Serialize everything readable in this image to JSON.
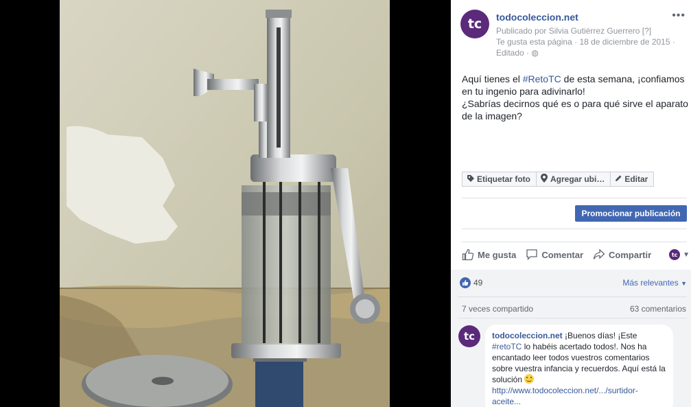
{
  "post": {
    "page_name": "todocoleccion.net",
    "avatar_text": "tc",
    "published_by": "Publicado por Silvia Gutiérrez Guerrero",
    "help_mark": "[?]",
    "liked_page": "Te gusta esta página",
    "date": "18 de diciembre de 2015",
    "edited": "Editado",
    "text_line1_prefix": "Aquí tienes el ",
    "text_hashtag": "#RetoTC",
    "text_line1_suffix": " de esta semana, ¡confiamos en tu ingenio para adivinarlo!",
    "text_line2": "¿Sabrías decirnos qué es o para qué sirve el aparato de la imagen?"
  },
  "photo_buttons": {
    "tag": "Etiquetar foto",
    "location": "Agregar ubi…",
    "edit": "Editar"
  },
  "promote_label": "Promocionar publicación",
  "actions": {
    "like": "Me gusta",
    "comment": "Comentar",
    "share": "Compartir"
  },
  "stats": {
    "likes": "49",
    "sort": "Más relevantes",
    "shares": "7 veces compartido",
    "comments": "63 comentarios"
  },
  "comment": {
    "author": "todocoleccion.net",
    "text_part1": " ¡Buenos días! ¡Este ",
    "hashtag": "#retoTC",
    "text_part2": " lo habéis acertado todos!. Nos ha encantado leer todos vuestros comentarios sobre vuestra infancia y recuerdos. Aquí está la solución ",
    "link": "http://www.todocoleccion.net/.../surtidor-aceite..."
  },
  "colors": {
    "brand": "#5b2a7a",
    "link": "#365899",
    "promote": "#4267b2"
  }
}
